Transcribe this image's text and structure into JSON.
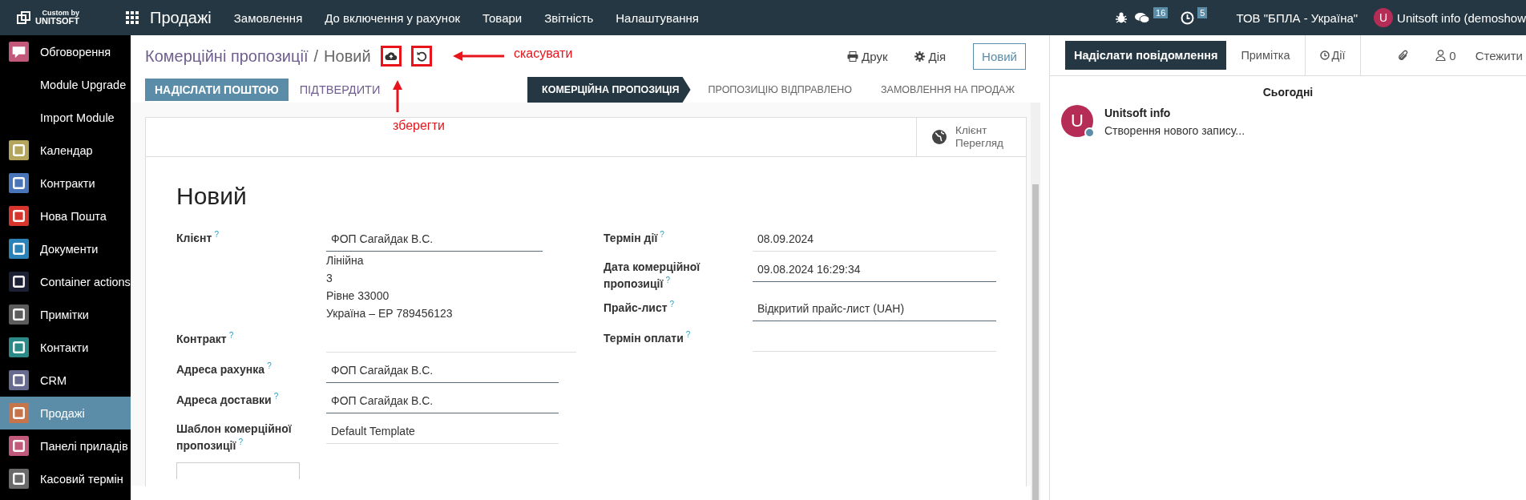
{
  "navbar": {
    "logo_top": "Custom by",
    "logo_bottom": "UNITSOFT",
    "app": "Продажі",
    "menu": [
      "Замовлення",
      "До включення у рахунок",
      "Товари",
      "Звітність",
      "Налаштування"
    ],
    "messages_count": "16",
    "activities_count": "5",
    "company": "ТОВ \"БПЛА - Україна\"",
    "user_initial": "U",
    "user": "Unitsoft info (demoshow"
  },
  "sidebar": {
    "items": [
      {
        "label": "Обговорення",
        "color": "#c2587a",
        "selected": false
      },
      {
        "label": "Module Upgrade",
        "selected": false
      },
      {
        "label": "Import Module",
        "selected": false
      },
      {
        "label": "Календар",
        "color": "#b3a55c",
        "selected": false
      },
      {
        "label": "Контракти",
        "color": "#4a74b8",
        "selected": false
      },
      {
        "label": "Нова Пошта",
        "color": "#d9342b",
        "selected": false
      },
      {
        "label": "Документи",
        "color": "#2a82b8",
        "selected": false
      },
      {
        "label": "Container actions",
        "color": "#1c2136",
        "selected": false
      },
      {
        "label": "Примітки",
        "color": "#5c5c5c",
        "selected": false
      },
      {
        "label": "Контакти",
        "color": "#2b8a87",
        "selected": false
      },
      {
        "label": "CRM",
        "color": "#676b8f",
        "selected": false
      },
      {
        "label": "Продажі",
        "color": "#c8744a",
        "selected": true
      },
      {
        "label": "Панелі приладів",
        "color": "#c2587a",
        "selected": false
      },
      {
        "label": "Касовий термін",
        "color": "#6a6a6a",
        "selected": false
      }
    ]
  },
  "breadcrumb": {
    "parent": "Комерційні пропозиції",
    "separator": "/",
    "current": "Новий"
  },
  "toolbar": {
    "print": "Друк",
    "action": "Дія",
    "new": "Новий"
  },
  "actions": [
    "НАДІСЛАТИ ПОШТОЮ",
    "ПІДТВЕРДИТИ"
  ],
  "stages": [
    {
      "label": "КОМЕРЦІЙНА ПРОПОЗИЦІЯ",
      "selected": true
    },
    {
      "label": "ПРОПОЗИЦІЮ ВІДПРАВЛЕНО",
      "selected": false
    },
    {
      "label": "ЗАМОВЛЕННЯ НА ПРОДАЖ",
      "selected": false
    }
  ],
  "annotations": [
    {
      "text": "скасувати"
    },
    {
      "text": "зберегти"
    }
  ],
  "smart_button": {
    "line1": "Клієнт",
    "line2": "Перегляд"
  },
  "form": {
    "title": "Новий",
    "left": [
      {
        "label": "Клієнт",
        "help": "?",
        "value": "ФОП Сагайдак В.С.",
        "required": true,
        "address": [
          "Лінійна",
          "3",
          "Рівне 33000",
          "Україна – ЕР 789456123"
        ]
      },
      {
        "label": "Контракт",
        "help": "?",
        "required": false
      },
      {
        "label": "Адреса рахунка",
        "help": "?",
        "value": "ФОП Сагайдак В.С.",
        "required": true
      },
      {
        "label": "Адреса доставки",
        "help": "?",
        "value": "ФОП Сагайдак В.С.",
        "required": true
      },
      {
        "label": "Шаблон комерційної пропозиції",
        "help": "?",
        "value": "Default Template",
        "required": false
      }
    ],
    "right": [
      {
        "label": "Термін дії",
        "help": "?",
        "value": "08.09.2024",
        "required": false
      },
      {
        "label": "Дата комерційної пропозиції",
        "help": "?",
        "value": "09.08.2024 16:29:34",
        "required": true
      },
      {
        "label": "Прайс-лист",
        "help": "?",
        "value": "Відкритий прайс-лист (UAH)",
        "required": true
      },
      {
        "label": "Термін оплати",
        "help": "?",
        "required": false
      }
    ]
  },
  "chatter": {
    "tabs": [
      {
        "label": "Надіслати повідомлення",
        "selected": true
      },
      {
        "label": "Примітка",
        "selected": false
      },
      {
        "label": "Дії",
        "selected": false
      }
    ],
    "followers": "0",
    "follow": "Стежити",
    "day": "Сьогодні",
    "message": {
      "initial": "U",
      "author": "Unitsoft info",
      "text": "Створення нового запису..."
    }
  }
}
